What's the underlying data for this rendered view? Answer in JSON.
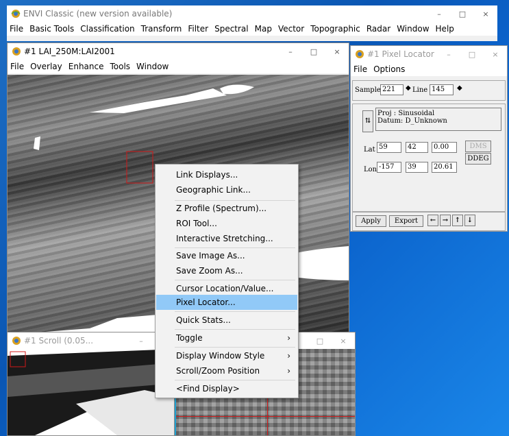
{
  "main_window": {
    "title": "ENVI Classic (new version available)",
    "menu": [
      "File",
      "Basic Tools",
      "Classification",
      "Transform",
      "Filter",
      "Spectral",
      "Map",
      "Vector",
      "Topographic",
      "Radar",
      "Window",
      "Help"
    ],
    "min": "–",
    "max": "□",
    "close": "×"
  },
  "image_window": {
    "title": "#1 LAI_250M:LAI2001",
    "menu": [
      "File",
      "Overlay",
      "Enhance",
      "Tools",
      "Window"
    ],
    "min": "–",
    "max": "□",
    "close": "×"
  },
  "pixel_locator": {
    "title": "#1 Pixel Locator",
    "menu": [
      "File",
      "Options"
    ],
    "min": "–",
    "max": "□",
    "close": "×",
    "sample_label": "Sample",
    "sample_value": "221",
    "line_label": "Line",
    "line_value": "145",
    "proj_line": "Proj : Sinusoidal",
    "datum_line": "Datum: D_Unknown",
    "lat_label": "Lat",
    "lat_deg": "59",
    "lat_min": "42",
    "lat_sec": "0.00",
    "lon_label": "Lon",
    "lon_deg": "-157",
    "lon_min": "39",
    "lon_sec": "20.61",
    "dms_label": "DMS",
    "ddeg_label": "DDEG",
    "apply_label": "Apply",
    "export_label": "Export"
  },
  "scroll_window": {
    "title": "#1 Scroll (0.05...",
    "min": "–",
    "max": "□",
    "close": "×"
  },
  "zoom_window": {
    "max": "□",
    "close": "×"
  },
  "context_menu": {
    "items": [
      {
        "label": "Link Displays..."
      },
      {
        "label": "Geographic Link..."
      },
      {
        "label": "Z Profile (Spectrum)..."
      },
      {
        "label": "ROI Tool..."
      },
      {
        "label": "Interactive Stretching..."
      },
      {
        "label": "Save Image As..."
      },
      {
        "label": "Save Zoom As..."
      },
      {
        "label": "Cursor Location/Value..."
      },
      {
        "label": "Pixel Locator..."
      },
      {
        "label": "Quick Stats..."
      },
      {
        "label": "Toggle"
      },
      {
        "label": "Display Window Style"
      },
      {
        "label": "Scroll/Zoom Position"
      },
      {
        "label": "<Find Display>"
      }
    ],
    "selected": "Pixel Locator...",
    "submenu_arrow": "›"
  },
  "colors": {
    "selection": "#91c9f7",
    "desktop": "#0a56b3",
    "box": "#d01818"
  }
}
